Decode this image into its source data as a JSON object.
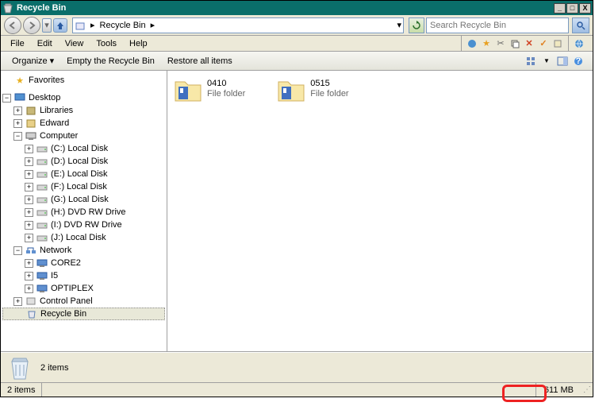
{
  "window": {
    "title": "Recycle Bin",
    "minimize": "_",
    "maximize": "□",
    "close": "X"
  },
  "nav": {
    "breadcrumb_root": "Recycle Bin",
    "search_placeholder": "Search Recycle Bin"
  },
  "menu": {
    "file": "File",
    "edit": "Edit",
    "view": "View",
    "tools": "Tools",
    "help": "Help"
  },
  "cmd": {
    "organize": "Organize",
    "empty": "Empty the Recycle Bin",
    "restore": "Restore all items"
  },
  "tree": {
    "favorites": "Favorites",
    "desktop": "Desktop",
    "libraries": "Libraries",
    "user": "Edward",
    "computer": "Computer",
    "drives": [
      "(C:) Local Disk",
      "(D:) Local Disk",
      "(E:) Local Disk",
      "(F:) Local Disk",
      "(G:) Local Disk",
      "(H:) DVD RW Drive",
      "(I:) DVD RW Drive",
      "(J:) Local Disk"
    ],
    "network": "Network",
    "nodes": [
      "CORE2",
      "I5",
      "OPTIPLEX"
    ],
    "cpanel": "Control Panel",
    "recycle": "Recycle Bin"
  },
  "items": [
    {
      "name": "0410",
      "type": "File folder"
    },
    {
      "name": "0515",
      "type": "File folder"
    }
  ],
  "details": {
    "summary": "2 items"
  },
  "status": {
    "count": "2 items",
    "size": "611 MB"
  }
}
